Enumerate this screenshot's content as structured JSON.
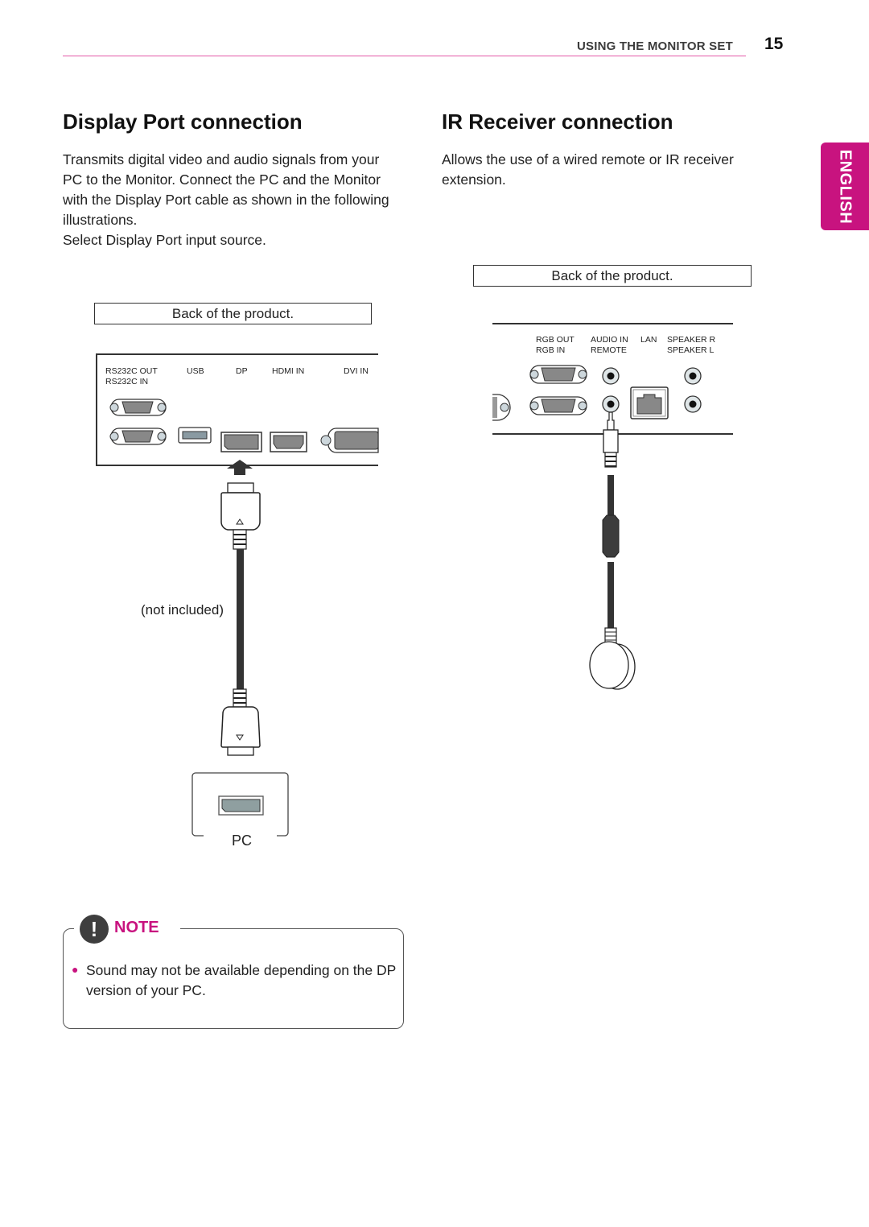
{
  "header": {
    "section_title": "USING THE MONITOR SET",
    "page_number": "15",
    "accent_color": "#c8137f"
  },
  "language_tab": {
    "label": "ENGLISH"
  },
  "display_port": {
    "title": "Display Port connection",
    "description": "Transmits digital video and audio signals from your PC to the Monitor. Connect the PC and the Monitor with the Display Port cable as shown in the following illustrations.",
    "instruction": "Select Display Port input source.",
    "caption": "Back of the product.",
    "port_labels": {
      "rs232c": [
        "RS232C OUT",
        "RS232C IN"
      ],
      "usb": "USB",
      "dp": "DP",
      "hdmi": "HDMI IN",
      "dvi": "DVI IN"
    },
    "cable_note": "(not included)",
    "pc_label": "PC"
  },
  "ir_receiver": {
    "title": "IR Receiver connection",
    "description": "Allows the use of a wired remote or IR receiver extension.",
    "caption": "Back of the product.",
    "port_labels": {
      "rgb": [
        "RGB OUT",
        "RGB IN"
      ],
      "audio": [
        "AUDIO IN",
        "REMOTE"
      ],
      "lan": "LAN",
      "speaker": [
        "SPEAKER R",
        "SPEAKER L"
      ]
    }
  },
  "note": {
    "title": "NOTE",
    "icon": "exclamation-icon",
    "items": [
      "Sound may not be available depending on the DP version of your PC."
    ]
  }
}
